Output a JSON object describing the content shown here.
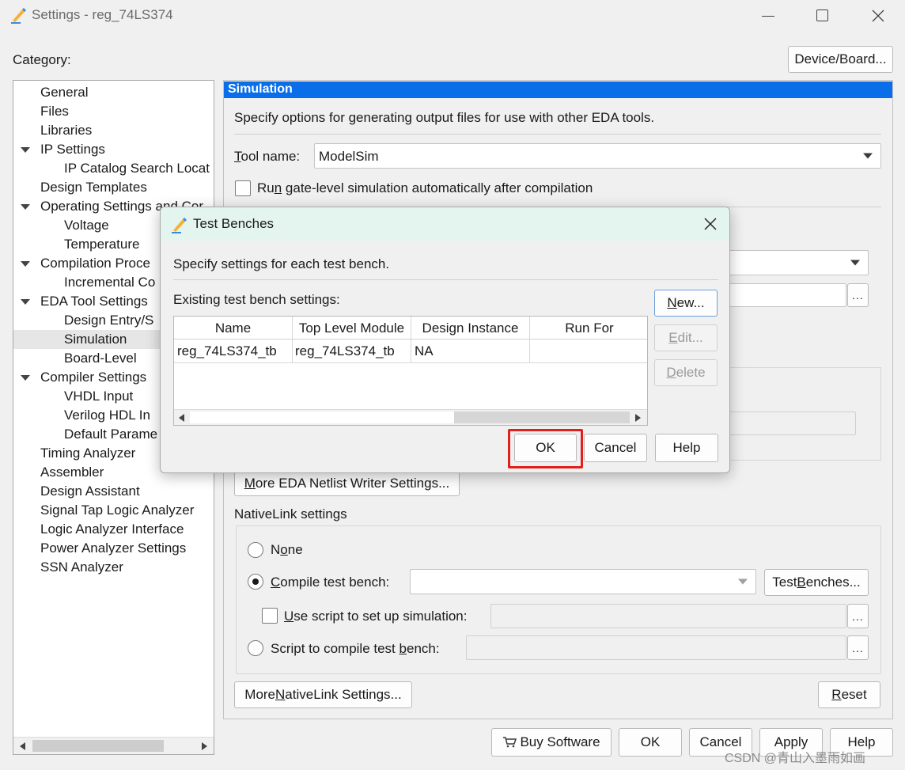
{
  "window": {
    "title": "Settings - reg_74LS374",
    "category_label": "Category:",
    "device_board_button": "Device/Board..."
  },
  "category_tree": [
    {
      "label": "General",
      "level": 0,
      "expanded": null
    },
    {
      "label": "Files",
      "level": 0,
      "expanded": null
    },
    {
      "label": "Libraries",
      "level": 0,
      "expanded": null
    },
    {
      "label": "IP Settings",
      "level": 0,
      "expanded": true
    },
    {
      "label": "IP Catalog Search Locat",
      "level": 1,
      "expanded": null
    },
    {
      "label": "Design Templates",
      "level": 0,
      "expanded": null
    },
    {
      "label": "Operating Settings and Cor",
      "level": 0,
      "expanded": true
    },
    {
      "label": "Voltage",
      "level": 1,
      "expanded": null
    },
    {
      "label": "Temperature",
      "level": 1,
      "expanded": null
    },
    {
      "label": "Compilation Proce",
      "level": 0,
      "expanded": true
    },
    {
      "label": "Incremental Co",
      "level": 1,
      "expanded": null
    },
    {
      "label": "EDA Tool Settings",
      "level": 0,
      "expanded": true
    },
    {
      "label": "Design Entry/S",
      "level": 1,
      "expanded": null
    },
    {
      "label": "Simulation",
      "level": 1,
      "expanded": null,
      "selected": true
    },
    {
      "label": "Board-Level",
      "level": 1,
      "expanded": null
    },
    {
      "label": "Compiler Settings",
      "level": 0,
      "expanded": true
    },
    {
      "label": "VHDL Input",
      "level": 1,
      "expanded": null
    },
    {
      "label": "Verilog HDL In",
      "level": 1,
      "expanded": null
    },
    {
      "label": "Default Parame",
      "level": 1,
      "expanded": null
    },
    {
      "label": "Timing Analyzer",
      "level": 0,
      "expanded": null
    },
    {
      "label": "Assembler",
      "level": 0,
      "expanded": null
    },
    {
      "label": "Design Assistant",
      "level": 0,
      "expanded": null
    },
    {
      "label": "Signal Tap Logic Analyzer",
      "level": 0,
      "expanded": null
    },
    {
      "label": "Logic Analyzer Interface",
      "level": 0,
      "expanded": null
    },
    {
      "label": "Power Analyzer Settings",
      "level": 0,
      "expanded": null
    },
    {
      "label": "SSN Analyzer",
      "level": 0,
      "expanded": null
    }
  ],
  "simulation": {
    "header": "Simulation",
    "description": "Specify options for generating output files for use with other EDA tools.",
    "tool_name_label": "Tool name:",
    "tool_name_value": "ModelSim",
    "run_gate_level_label": "Run gate-level simulation automatically after compilation",
    "more_eda_netlist_button": "More EDA Netlist Writer Settings...",
    "nativelink_label": "NativeLink settings",
    "none_label": "None",
    "compile_test_bench_label": "Compile test bench:",
    "compile_test_bench_value": "",
    "test_benches_button": "Test Benches...",
    "use_script_label": "Use script to set up simulation:",
    "script_compile_label": "Script to compile test bench:",
    "browse_label": "...",
    "more_nativelink_button": "More NativeLink Settings...",
    "reset_button": "Reset"
  },
  "footer": {
    "buy_software": "Buy Software",
    "ok": "OK",
    "cancel": "Cancel",
    "apply": "Apply",
    "help": "Help"
  },
  "dialog": {
    "title": "Test Benches",
    "description": "Specify settings for each test bench.",
    "existing_label": "Existing test bench settings:",
    "new_button": "New...",
    "edit_button": "Edit...",
    "delete_button": "Delete",
    "columns": [
      "Name",
      "Top Level Module",
      "Design Instance",
      "Run For"
    ],
    "rows": [
      [
        "reg_74LS374_tb",
        "reg_74LS374_tb",
        "NA",
        ""
      ]
    ],
    "ok_button": "OK",
    "cancel_button": "Cancel",
    "help_button": "Help"
  },
  "watermark": "CSDN @青山入墨雨如画",
  "colors": {
    "accent": "#0a6ee8",
    "highlight_border": "#e0201c",
    "dialog_titlebar": "#e4f4ee"
  }
}
